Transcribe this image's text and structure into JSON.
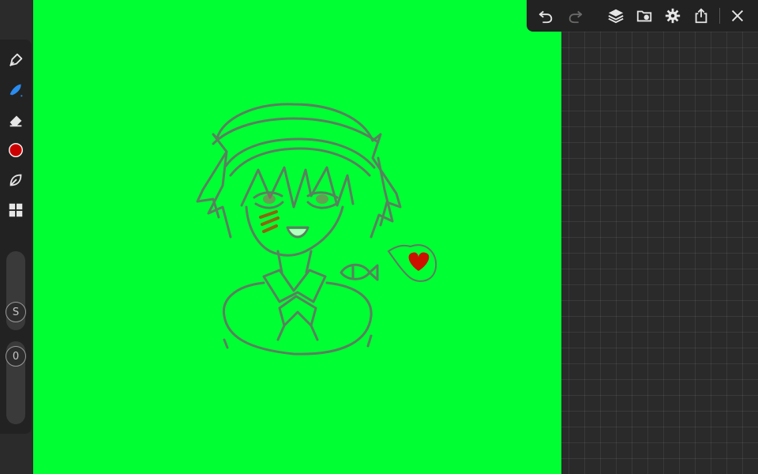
{
  "app": {
    "canvas_color": "#00ff33",
    "workspace_color": "#2a2a2a",
    "toolbar_color": "#222222"
  },
  "toolbar": {
    "tools": [
      {
        "name": "pen",
        "icon": "pen-nib-icon",
        "active": false
      },
      {
        "name": "brush",
        "icon": "brush-icon",
        "active": true,
        "accent": "#2a8cf0"
      },
      {
        "name": "eraser",
        "icon": "eraser-icon",
        "active": false
      },
      {
        "name": "color",
        "icon": "color-swatch",
        "color": "#cc0000"
      },
      {
        "name": "lasso",
        "icon": "lasso-leaf-icon",
        "active": false
      },
      {
        "name": "more",
        "icon": "grid-icon",
        "active": false
      }
    ],
    "size_slider": {
      "badge": "S"
    },
    "opacity_slider": {
      "badge": "0"
    }
  },
  "topbar": {
    "buttons": [
      {
        "name": "undo",
        "icon": "undo-icon",
        "enabled": true
      },
      {
        "name": "redo",
        "icon": "redo-icon",
        "enabled": false
      },
      {
        "name": "layers",
        "icon": "layers-icon"
      },
      {
        "name": "gallery",
        "icon": "folder-palette-icon"
      },
      {
        "name": "settings",
        "icon": "gear-icon"
      },
      {
        "name": "share",
        "icon": "share-icon"
      },
      {
        "name": "close",
        "icon": "close-icon"
      }
    ]
  }
}
